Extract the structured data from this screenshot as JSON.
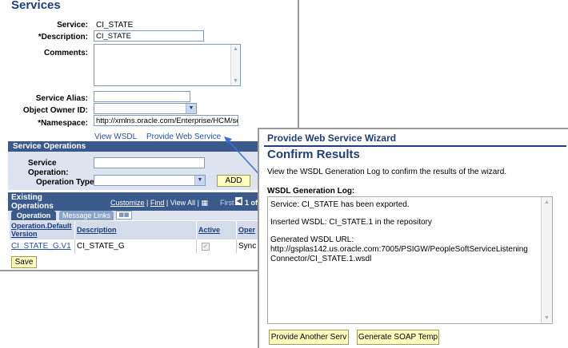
{
  "services": {
    "title": "Services",
    "service_label": "Service:",
    "service_value": "CI_STATE",
    "description_label": "*Description:",
    "description_value": "CI_STATE",
    "comments_label": "Comments:",
    "alias_label": "Service Alias:",
    "owner_label": "Object Owner ID:",
    "namespace_label": "*Namespace:",
    "namespace_value": "http://xmlns.oracle.com/Enterprise/HCM/ser",
    "view_wsdl_link": "View WSDL",
    "provide_ws_link": "Provide Web Service"
  },
  "service_operations": {
    "title": "Service Operations",
    "op_label_1": "Service",
    "op_label_2": "Operation:",
    "op_type_label": "Operation Type:",
    "add_button": "ADD"
  },
  "existing_ops": {
    "title_1": "Existing",
    "title_2": "Operations",
    "customize_link": "Customize",
    "separator_1": "|",
    "find_link": "Find",
    "separator_2": "|",
    "view_all_link": "View All",
    "separator_3": "|",
    "first_label": "First",
    "pager_text": "1 of",
    "tabs": [
      "Operation",
      "Message Links"
    ],
    "columns": [
      "Operation.Default Version",
      "Description",
      "Active",
      "Oper"
    ],
    "rows": [
      {
        "operation": "CI_STATE_G.V1",
        "description": "CI_STATE_G",
        "active": "✓",
        "type": "Sync"
      }
    ],
    "save_button": "Save"
  },
  "wizard": {
    "title": "Provide Web Service Wizard",
    "subtitle": "Confirm Results",
    "instruction": "View the WSDL Generation Log to confirm the results of the wizard.",
    "log_label": "WSDL Generation Log:",
    "log_lines": [
      "Service: CI_STATE has been exported.",
      "Inserted WSDL: CI_STATE.1 in the repository",
      "Generated WSDL URL:",
      "http://gsplas142.us.oracle.com:7005/PSIGW/PeopleSoftServiceListening",
      "Connector/CI_STATE.1.wsdl"
    ],
    "another_button": "Provide Another Serv",
    "soap_button": "Generate SOAP Temp"
  },
  "colors": {
    "heading": "#1f3e7a",
    "section_bar": "#3a5a8c",
    "link": "#2a50a8",
    "button_bg": "#ffffc0",
    "connector": "#3c6ee0"
  },
  "icons": [
    "dropdown-arrow-icon",
    "grid-icon",
    "nav-left-icon",
    "spreadsheet-tab-icon",
    "checkbox-icon"
  ]
}
